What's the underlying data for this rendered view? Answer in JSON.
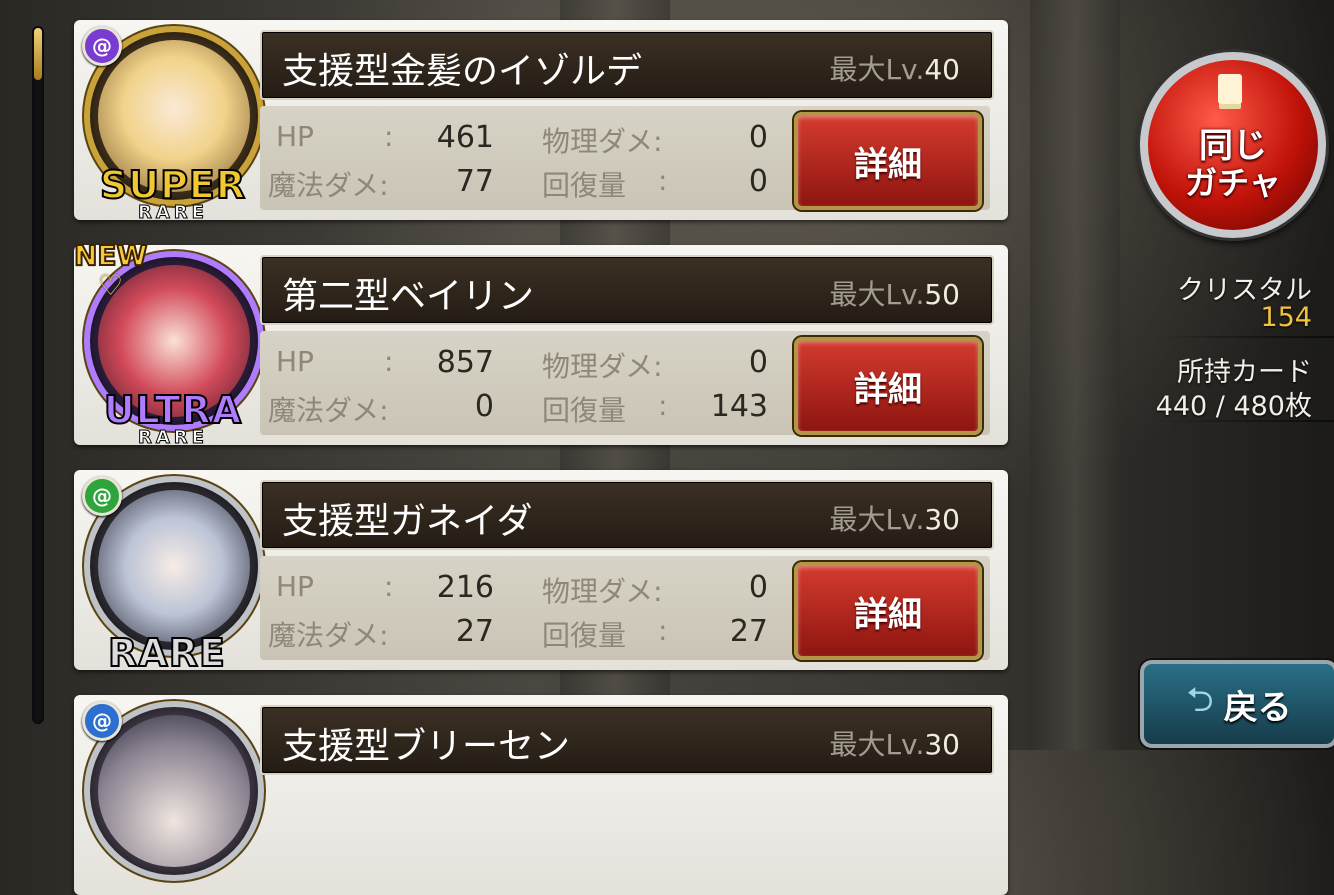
{
  "cards": [
    {
      "name": "支援型金髪のイゾルデ",
      "lv_prefix": "最大Lv.",
      "lv": "40",
      "rarity_big": "SUPER",
      "rarity_small": "RARE",
      "rarity_color": "#f2c832",
      "element_icon": "purple-swirl-icon",
      "element_color": "#7a3bd0",
      "new": false,
      "hp_label": "HP",
      "hp": "461",
      "phys_label": "物理ダメ:",
      "phys": "0",
      "magic_label": "魔法ダメ:",
      "magic": "77",
      "heal_label": "回復量",
      "heal": "0",
      "detail_label": "詳細"
    },
    {
      "name": "第二型ベイリン",
      "lv_prefix": "最大Lv.",
      "lv": "50",
      "rarity_big": "ULTRA",
      "rarity_small": "RARE",
      "rarity_color": "#b07cff",
      "element_icon": "heart-icon",
      "element_color": "#f7c83a",
      "new": true,
      "new_label": "NEW",
      "hp_label": "HP",
      "hp": "857",
      "phys_label": "物理ダメ:",
      "phys": "0",
      "magic_label": "魔法ダメ:",
      "magic": "0",
      "heal_label": "回復量",
      "heal": "143",
      "detail_label": "詳細"
    },
    {
      "name": "支援型ガネイダ",
      "lv_prefix": "最大Lv.",
      "lv": "30",
      "rarity_big": "RARE",
      "rarity_small": "",
      "rarity_color": "#dcdcdc",
      "element_icon": "green-swirl-icon",
      "element_color": "#2fa43a",
      "new": false,
      "hp_label": "HP",
      "hp": "216",
      "phys_label": "物理ダメ:",
      "phys": "0",
      "magic_label": "魔法ダメ:",
      "magic": "27",
      "heal_label": "回復量",
      "heal": "27",
      "detail_label": "詳細"
    },
    {
      "name": "支援型ブリーセン",
      "lv_prefix": "最大Lv.",
      "lv": "30",
      "element_icon": "blue-swirl-icon",
      "element_color": "#2b6fd0"
    }
  ],
  "sidebar": {
    "gacha_line1": "同じ",
    "gacha_line2": "ガチャ",
    "crystal_label": "クリスタル",
    "crystal_value": "154",
    "crystal_color": "#f3c23c",
    "cards_label": "所持カード",
    "cards_value": "440 / 480枚",
    "back_label": "戻る"
  },
  "colon": ":"
}
